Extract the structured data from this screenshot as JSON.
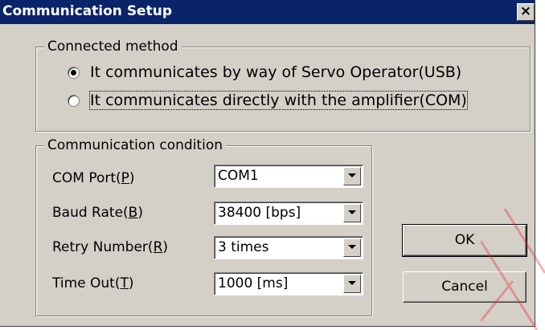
{
  "window": {
    "title": "Communication Setup",
    "close_glyph": "×"
  },
  "connected_method": {
    "legend": "Connected method",
    "options": [
      {
        "label": "It communicates by way of Servo Operator(USB)",
        "selected": true
      },
      {
        "label": "It communicates directly with the amplifier(COM)",
        "selected": false
      }
    ]
  },
  "communication_condition": {
    "legend": "Communication condition",
    "fields": [
      {
        "label_prefix": "COM Port(",
        "accel": "P",
        "label_suffix": ")",
        "value": "COM1"
      },
      {
        "label_prefix": "Baud Rate(",
        "accel": "B",
        "label_suffix": ")",
        "value": "38400 [bps]"
      },
      {
        "label_prefix": "Retry Number(",
        "accel": "R",
        "label_suffix": ")",
        "value": "3 times"
      },
      {
        "label_prefix": "Time Out(",
        "accel": "T",
        "label_suffix": ")",
        "value": "1000 [ms]"
      }
    ]
  },
  "buttons": {
    "ok_label": "OK",
    "cancel_label": "Cancel"
  },
  "colors": {
    "titlebar": "#0a246a",
    "face": "#d4d0c8",
    "watermark": "#e8252a"
  }
}
